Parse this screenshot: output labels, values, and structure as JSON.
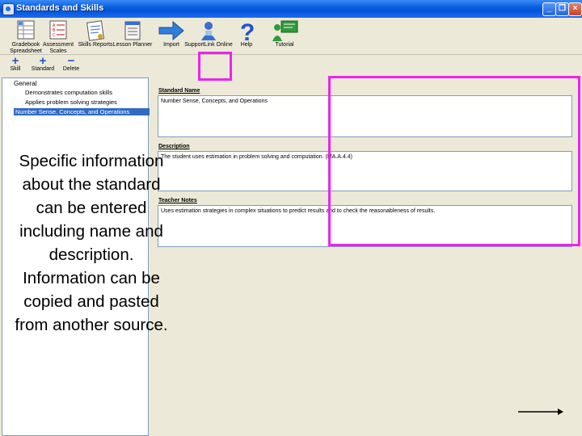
{
  "window": {
    "title": "Standards and Skills",
    "controls": [
      "_",
      "❐",
      "×"
    ]
  },
  "toolbar": {
    "items": [
      {
        "id": "gradebook",
        "label": "Gradebook Spreadsheet",
        "icon": "gradebook-icon"
      },
      {
        "id": "assessment",
        "label": "Assessment Scales",
        "icon": "assessment-scales-icon"
      },
      {
        "id": "skills",
        "label": "Skills Reports",
        "icon": "skills-reports-icon"
      },
      {
        "id": "lesson",
        "label": "Lesson Planner",
        "icon": "lesson-planner-icon"
      },
      {
        "id": "import",
        "label": "Import",
        "icon": "import-arrow-icon"
      },
      {
        "id": "support",
        "label": "SupportLink Online",
        "icon": "supportlink-icon"
      },
      {
        "id": "help",
        "label": "Help",
        "icon": "help-icon"
      },
      {
        "id": "tutorial",
        "label": "Tutorial",
        "icon": "tutorial-icon"
      }
    ]
  },
  "subtoolbar": {
    "skill": {
      "symbol": "+",
      "label": "Skill"
    },
    "standard": {
      "symbol": "+",
      "label": "Standard"
    },
    "delete": {
      "symbol": "−",
      "label": "Delete"
    }
  },
  "tree": {
    "root": "General",
    "items": [
      "Demonstrates computation skills",
      "Applies problem solving strategies",
      "Number Sense, Concepts, and Operations"
    ]
  },
  "form": {
    "name_label": "Standard Name",
    "name_value": "Number Sense, Concepts, and Operations",
    "desc_label": "Description",
    "desc_value": "The student uses estimation in problem solving and computation. (MA.A.4.4)",
    "notes_label": "Teacher Notes",
    "notes_value": "Uses estimation strategies in complex situations to predict results and to check the reasonableness of results."
  },
  "overlay_text": "Specific information about the standard can be entered including name and description. Information can be copied and pasted from another source.",
  "colors": {
    "highlight": "#ee22ee",
    "titlebar": "#0553d6",
    "selection": "#316ac5"
  }
}
